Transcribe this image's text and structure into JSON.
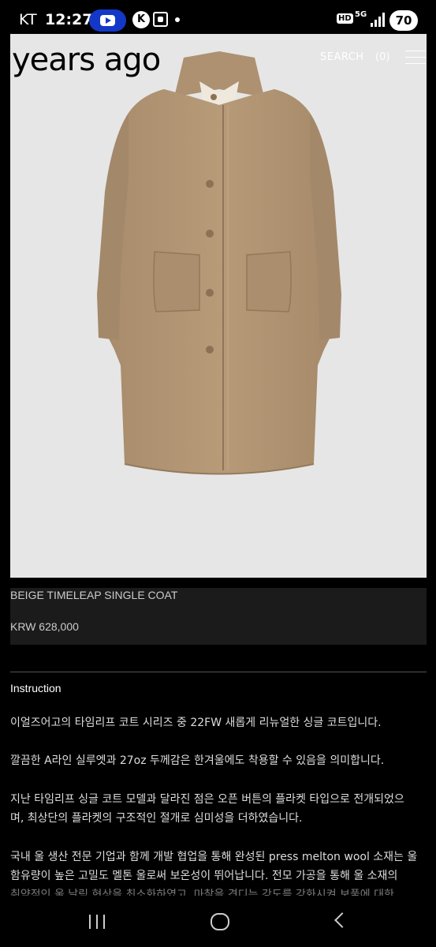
{
  "status_bar": {
    "carrier": "KT",
    "time": "12:27",
    "battery": "70",
    "network": "5G",
    "hd": "HD",
    "icons": [
      "youtube-icon",
      "k-app-icon",
      "scan-icon",
      "dot-icon",
      "hd-icon",
      "5g-icon",
      "signal-icon",
      "battery-icon"
    ]
  },
  "header": {
    "logo": "years ago",
    "search_label": "SEARCH",
    "cart_count": "(0)",
    "menu_icon": "hamburger-menu-icon"
  },
  "product": {
    "image_alt_icon": "coat-image",
    "coat_color": "#b39877",
    "name": "BEIGE TIMELEAP SINGLE COAT",
    "price": "KRW 628,000"
  },
  "instruction": {
    "title": "Instruction",
    "lines": [
      "이얼즈어고의 타임리프 코트 시리즈 중 22FW 새롭게 리뉴얼한 싱글 코트입니다.",
      "깔끔한 A라인 실루엣과 27oz 두께감은 한겨울에도 착용할 수 있음을 의미합니다.",
      "지난 타임리프 싱글 코트 모델과 달라진 점은 오픈 버튼의 플라켓 타입으로 전개되었으",
      "며, 최상단의 플라켓의 구조적인 절개로 심미성을 더하였습니다.",
      "국내 울 생산 전문 기업과 함께 개발 협업을 통해 완성된 press melton wool 소재는 울",
      "함유량이 높은 고밀도 멜톤 울로써 보온성이 뛰어납니다. 전모 가공을 통해 울 소재의",
      "취약점인 울 날림 현상을 최소화하였고, 마찰을 견디는 강도를 강화시켜 보풀에 대한"
    ]
  },
  "nav_bar": {
    "icons": [
      "recents-icon",
      "home-icon",
      "back-icon"
    ]
  },
  "colors": {
    "background": "#000000",
    "image_bg": "#e6e6e6",
    "panel_bg": "#1b1b1b",
    "youtube_pill": "#1338c8"
  }
}
